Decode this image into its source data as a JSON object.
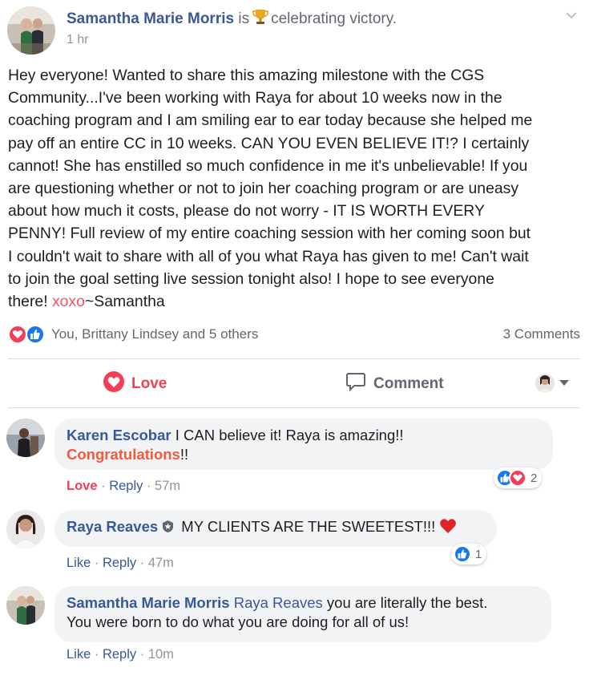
{
  "post": {
    "author": "Samantha Marie Morris",
    "status_is": "is",
    "status_activity": "celebrating victory.",
    "time": "1 hr",
    "body_lines": [
      "Hey everyone! Wanted to share this amazing milestone with the CGS",
      "Community...I've been working with Raya for about 10 weeks now in the",
      "coaching program and I am smiling ear to ear today because she helped me",
      "pay off an entire CC in 10 weeks. CAN YOU EVEN BELIEVE IT!? I certainly",
      "cannot! She has enstilled so much confidence in me it's unbelievable! If you",
      "are questioning whether or not to join her coaching program or are uneasy",
      "about how much it costs, please do not worry - IT IS WORTH EVERY",
      "PENNY! Full review of my entire coaching session with her coming soon but",
      "I couldn't wait to share with all of you what Raya has given to me! Can't wait",
      "to join the goal setting live session tonight also! I hope to see everyone"
    ],
    "body_last_prefix": "there! ",
    "body_last_highlight": "xoxo",
    "body_last_suffix": "~Samantha",
    "reactions_text": "You, Brittany Lindsey and 5 others",
    "comments_count": "3 Comments"
  },
  "actions": {
    "love_label": "Love",
    "comment_label": "Comment"
  },
  "comments": [
    {
      "name": "Karen Escobar",
      "text": " I CAN believe it! Raya is amazing!!",
      "text2_highlight": "Congratulations",
      "text2_suffix": "!!",
      "meta_reaction": "Love",
      "meta_reply": "Reply",
      "meta_time": "57m",
      "reaction_count": "2"
    },
    {
      "name": "Raya Reaves",
      "text": " MY CLIENTS ARE THE SWEETEST!!! ",
      "meta_reaction": "Like",
      "meta_reply": "Reply",
      "meta_time": "47m",
      "reaction_count": "1"
    },
    {
      "name": "Samantha Marie Morris",
      "mention": "Raya Reaves",
      "text": " you are literally the best.",
      "text_line2": "You were born to do what you are doing for all of us!",
      "meta_reaction": "Like",
      "meta_reply": "Reply",
      "meta_time": "10m"
    }
  ],
  "colors": {
    "link_blue": "#385898",
    "love_red": "#f33e58",
    "like_blue": "#1877f2",
    "meta_gray": "#90949c",
    "bubble_bg": "#f2f3f5"
  },
  "icons": [
    "trophy-icon",
    "chevron-down-icon",
    "like-reaction-icon",
    "love-reaction-icon",
    "comment-icon",
    "heart-icon",
    "admin-badge-icon",
    "red-heart-emoji"
  ]
}
